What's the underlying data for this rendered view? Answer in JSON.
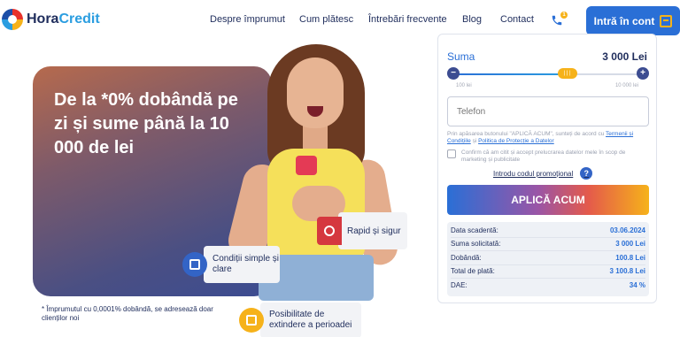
{
  "brand": {
    "name_a": "Hora",
    "name_b": "Credit"
  },
  "nav": {
    "items": [
      "Despre împrumut",
      "Cum plătesc",
      "Întrebări frecvente",
      "Blog",
      "Contact"
    ],
    "phone_badge": "1"
  },
  "header_cta": "Intră în cont",
  "hero": {
    "title": "De la *0% dobândă pe zi și sume până la 10 000 de lei"
  },
  "features": {
    "fast": "Rapid și sigur",
    "simple": "Condiții simple și clare",
    "extend": "Posibilitate de extindere a perioadei"
  },
  "footnote": "* Împrumutul cu 0,0001% dobândă, se adresează doar clienților noi",
  "form": {
    "amount_label": "Suma",
    "amount_value": "3 000 Lei",
    "slider_thumb": "| | |",
    "slider_fraction": 0.6,
    "min_label": "100 lei",
    "max_label": "10 000 lei",
    "phone_placeholder": "Telefon",
    "terms_pre": "Prin apăsarea butonului \"APLICĂ ACUM\", sunteți de acord cu",
    "terms_link1": "Termenii și Condițiile",
    "terms_mid": "și",
    "terms_link2": "Politica de Protecție a Datelor",
    "consent": "Confirm că am citit și accept prelucrarea datelor mele în scop de marketing și publicitate",
    "promo": "Introdu codul promoțional",
    "help": "?",
    "apply": "APLICĂ ACUM"
  },
  "summary": [
    {
      "label": "Data scadentă:",
      "value": "03.06.2024"
    },
    {
      "label": "Suma solicitată:",
      "value": "3 000 Lei"
    },
    {
      "label": "Dobândă:",
      "value": "100.8 Lei"
    },
    {
      "label": "Total de plată:",
      "value": "3 100.8 Lei"
    },
    {
      "label": "DAE:",
      "value": "34 %"
    }
  ]
}
